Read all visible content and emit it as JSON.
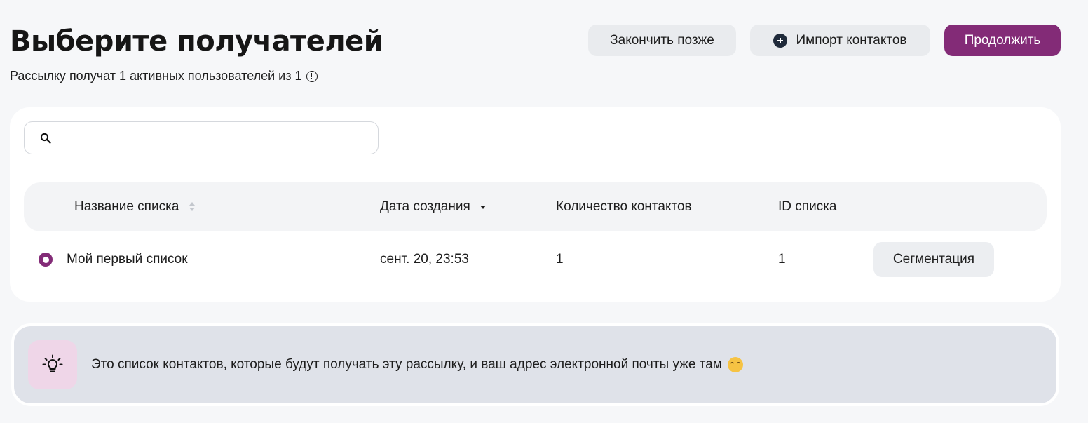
{
  "header": {
    "title": "Выберите получателей",
    "subtitle": "Рассылку получат 1 активных пользователей из 1",
    "buttons": {
      "finish_later": "Закончить позже",
      "import_contacts": "Импорт контактов",
      "continue": "Продолжить"
    }
  },
  "search": {
    "value": "",
    "placeholder": ""
  },
  "table": {
    "columns": {
      "name": "Название списка",
      "created": "Дата создания",
      "count": "Количество контактов",
      "id": "ID списка"
    },
    "rows": [
      {
        "name": "Мой первый список",
        "created": "сент. 20, 23:53",
        "count": "1",
        "id": "1",
        "action": "Сегментация",
        "selected": true
      }
    ]
  },
  "tip": {
    "text": "Это список контактов, которые будут получать эту рассылку, и ваш адрес электронной почты уже там"
  },
  "colors": {
    "accent": "#832b77",
    "background": "#f6f7f9",
    "card": "#ffffff",
    "tip_background": "#dfe2e9",
    "tip_icon_background": "#efd6e8"
  },
  "icons": {
    "info": "info-circle-icon",
    "import": "plus-circle-icon",
    "search": "search-icon",
    "sort": "sort-icon",
    "sort_active": "caret-down-icon",
    "tip": "lightbulb-icon",
    "emoji": "hugging-face-emoji-icon"
  }
}
